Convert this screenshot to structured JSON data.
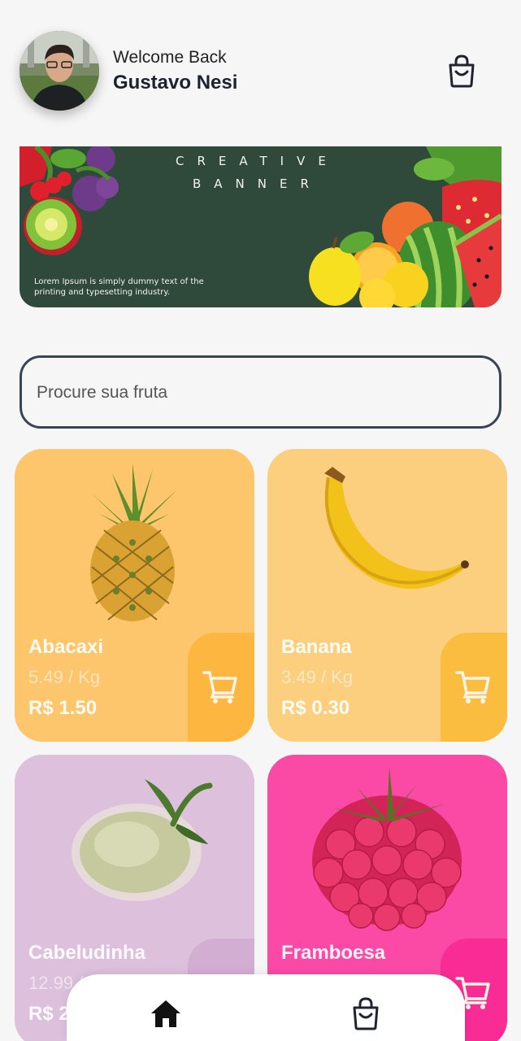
{
  "header": {
    "greeting": "Welcome Back",
    "user_name": "Gustavo Nesi",
    "avatar_icon": "user-photo",
    "cart_icon": "shopping-bag-icon"
  },
  "banner": {
    "title_line1": "CREATIVE",
    "title_line2": "BANNER",
    "text": "Lorem Ipsum is simply dummy text of the printing and typesetting industry."
  },
  "search": {
    "placeholder": "Procure sua fruta",
    "value": ""
  },
  "products": [
    {
      "name": "Abacaxi",
      "unit_price": "5.49 / Kg",
      "price": "R$ 1.50",
      "icon": "pineapple-image",
      "color": "#fdc56c"
    },
    {
      "name": "Banana",
      "unit_price": "3.49 / Kg",
      "price": "R$ 0.30",
      "icon": "banana-image",
      "color": "#fbcf7e"
    },
    {
      "name": "Cabeludinha",
      "unit_price": "12.99 / Kg",
      "price": "R$ 2",
      "icon": "cabeludinha-image",
      "color": "#dcc0dc"
    },
    {
      "name": "Framboesa",
      "unit_price": "",
      "price": "",
      "icon": "raspberry-image",
      "color": "#fb4aa6"
    }
  ],
  "nav": {
    "home_icon": "home-icon",
    "cart_icon": "shopping-bag-icon"
  }
}
